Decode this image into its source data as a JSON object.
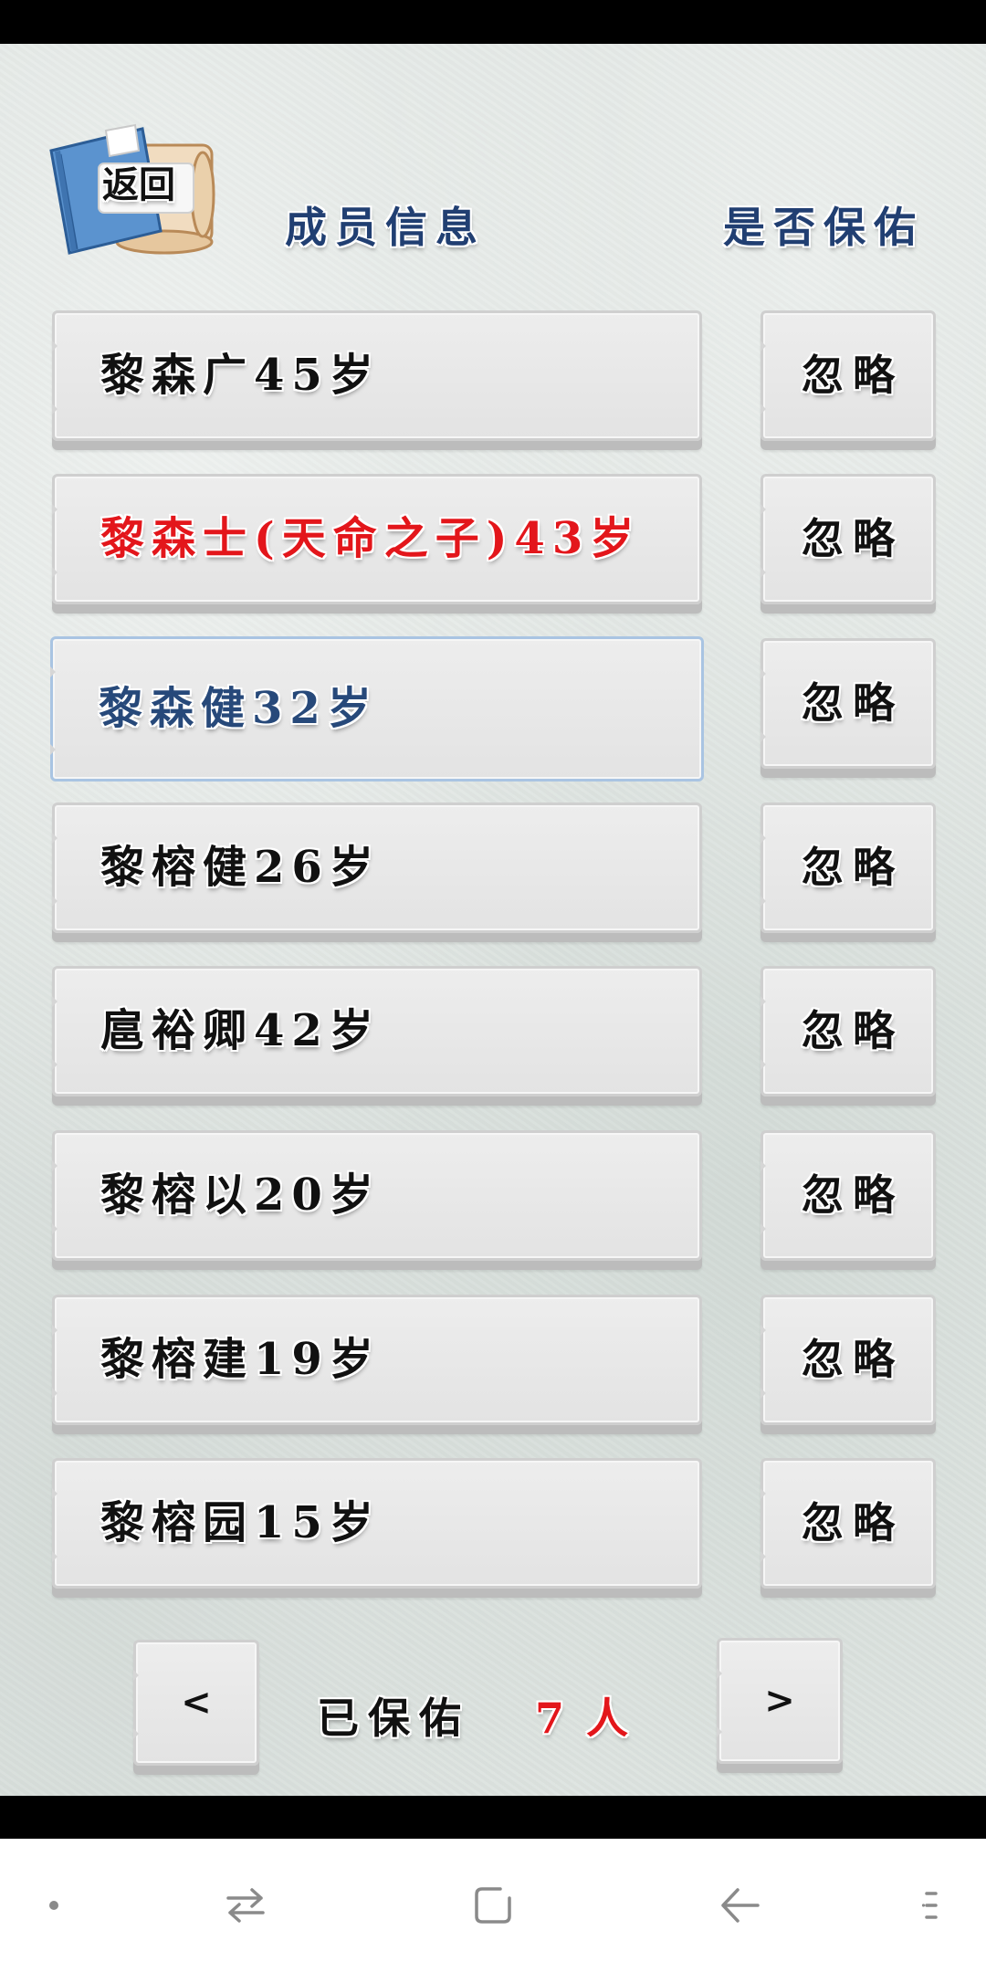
{
  "header": {
    "back_label": "返回",
    "column_member_info": "成员信息",
    "column_bless": "是否保佑"
  },
  "members": [
    {
      "label": "黎森广45岁",
      "action": "忽略",
      "text_color": "#111111"
    },
    {
      "label": "黎森士(天命之子)43岁",
      "action": "忽略",
      "text_color": "#e3161b"
    },
    {
      "label": "黎森健32岁",
      "action": "忽略",
      "text_color": "#27497a",
      "selected": true
    },
    {
      "label": "黎榕健26岁",
      "action": "忽略",
      "text_color": "#111111"
    },
    {
      "label": "扈裕卿42岁",
      "action": "忽略",
      "text_color": "#111111"
    },
    {
      "label": "黎榕以20岁",
      "action": "忽略",
      "text_color": "#111111"
    },
    {
      "label": "黎榕建19岁",
      "action": "忽略",
      "text_color": "#111111"
    },
    {
      "label": "黎榕园15岁",
      "action": "忽略",
      "text_color": "#111111"
    }
  ],
  "pager": {
    "prev": "<",
    "blessed_label": "已保佑",
    "blessed_count": "7",
    "blessed_unit": "人",
    "next": ">"
  },
  "nav_bar": {
    "icons": [
      "dot-icon",
      "switch-apps-icon",
      "home-square-icon",
      "back-arrow-icon",
      "menu-icon"
    ]
  },
  "colors": {
    "header_text": "#213f72",
    "accent_red": "#e3161b",
    "selected_text": "#27497a",
    "selected_border": "#a9c4e2",
    "book_cover": "#5b93cf"
  }
}
